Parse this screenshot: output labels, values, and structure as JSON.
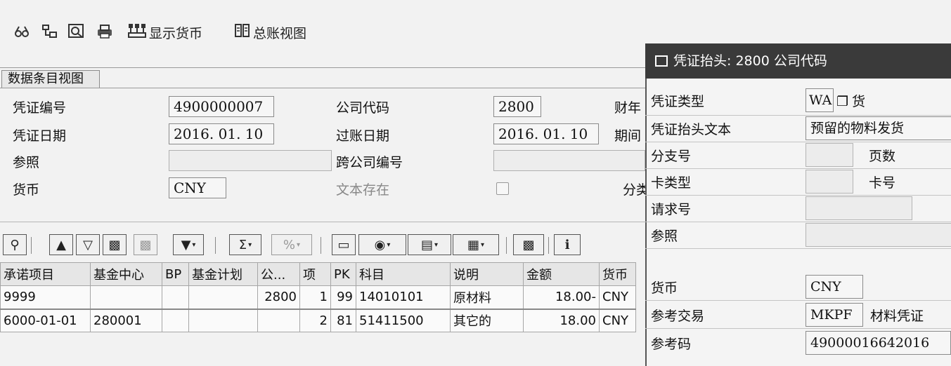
{
  "toolbar": {
    "icons": [
      "glasses-icon",
      "tree-icon",
      "search-icon",
      "print-icon"
    ],
    "display_currency_label": "显示货币",
    "ledger_view_label": "总账视图"
  },
  "entry_view": {
    "title": "数据条目视图",
    "fields": {
      "doc_number_label": "凭证编号",
      "doc_number": "4900000007",
      "company_code_label": "公司代码",
      "company_code": "2800",
      "fiscal_year_label": "财年",
      "doc_date_label": "凭证日期",
      "doc_date": "2016. 01. 10",
      "posting_date_label": "过账日期",
      "posting_date": "2016. 01. 10",
      "period_label": "期间",
      "reference_label": "参照",
      "reference": "",
      "cross_company_label": "跨公司编号",
      "cross_company": "",
      "currency_label": "货币",
      "currency": "CNY",
      "text_exists_label": "文本存在",
      "ledger_group_label": "分类"
    }
  },
  "grid": {
    "columns": [
      "承诺项目",
      "基金中心",
      "BP",
      "基金计划",
      "公...",
      "项",
      "PK",
      "科目",
      "说明",
      "金额",
      "货币"
    ],
    "rows": [
      [
        "9999",
        "",
        "",
        "",
        "2800",
        "1",
        "99",
        "14010101",
        "原材料",
        "18.00-",
        "CNY"
      ],
      [
        "6000-01-01",
        "280001",
        "",
        "",
        "",
        "2",
        "81",
        "51411500",
        "其它的",
        "18.00",
        "CNY"
      ]
    ]
  },
  "popup": {
    "title": "凭证抬头: 2800 公司代码",
    "doc_type_label": "凭证类型",
    "doc_type": "WA",
    "doc_type_desc": "货",
    "header_text_label": "凭证抬头文本",
    "header_text": "预留的物料发货",
    "branch_label": "分支号",
    "page_count_label": "页数",
    "card_type_label": "卡类型",
    "card_no_label": "卡号",
    "request_label": "请求号",
    "reference_label": "参照",
    "currency_label": "货币",
    "currency": "CNY",
    "ref_tx_label": "参考交易",
    "ref_tx": "MKPF",
    "ref_tx_desc": "材料凭证",
    "ref_key_label": "参考码",
    "ref_key": "49000016642016"
  }
}
